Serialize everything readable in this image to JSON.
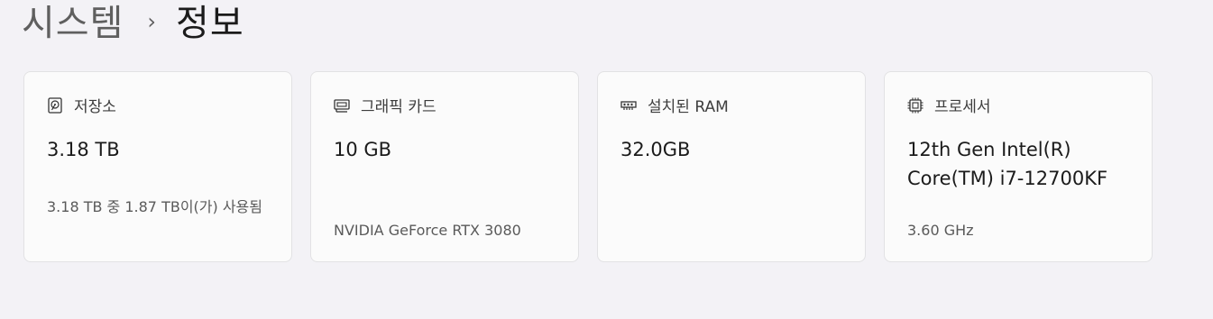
{
  "breadcrumb": {
    "parent": "시스템",
    "separator": "›",
    "current": "정보"
  },
  "cards": [
    {
      "icon": "storage-drive-icon",
      "label": "저장소",
      "value": "3.18 TB",
      "detail": "3.18 TB 중 1.87 TB이(가) 사용됨"
    },
    {
      "icon": "graphics-card-icon",
      "label": "그래픽 카드",
      "value": "10 GB",
      "detail": "NVIDIA GeForce RTX 3080"
    },
    {
      "icon": "ram-module-icon",
      "label": "설치된 RAM",
      "value": "32.0GB",
      "detail": ""
    },
    {
      "icon": "processor-chip-icon",
      "label": "프로세서",
      "value": "12th Gen Intel(R) Core(TM) i7-12700KF",
      "detail": "3.60 GHz"
    }
  ]
}
